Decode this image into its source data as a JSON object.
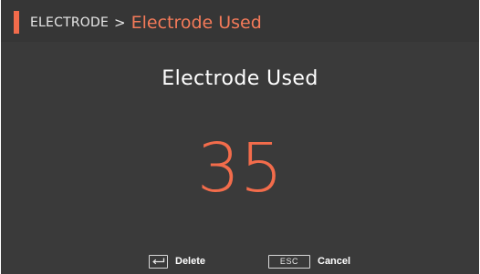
{
  "header": {
    "breadcrumb_parent": "ELECTRODE",
    "breadcrumb_separator": ">",
    "breadcrumb_current": "Electrode Used"
  },
  "main": {
    "title": "Electrode Used",
    "value": "35"
  },
  "footer": {
    "delete_key_icon": "enter-key-icon",
    "delete_label": "Delete",
    "cancel_key": "ESC",
    "cancel_label": "Cancel"
  },
  "colors": {
    "background": "#3a3a3a",
    "accent": "#f36c4b",
    "text": "#ffffff"
  }
}
